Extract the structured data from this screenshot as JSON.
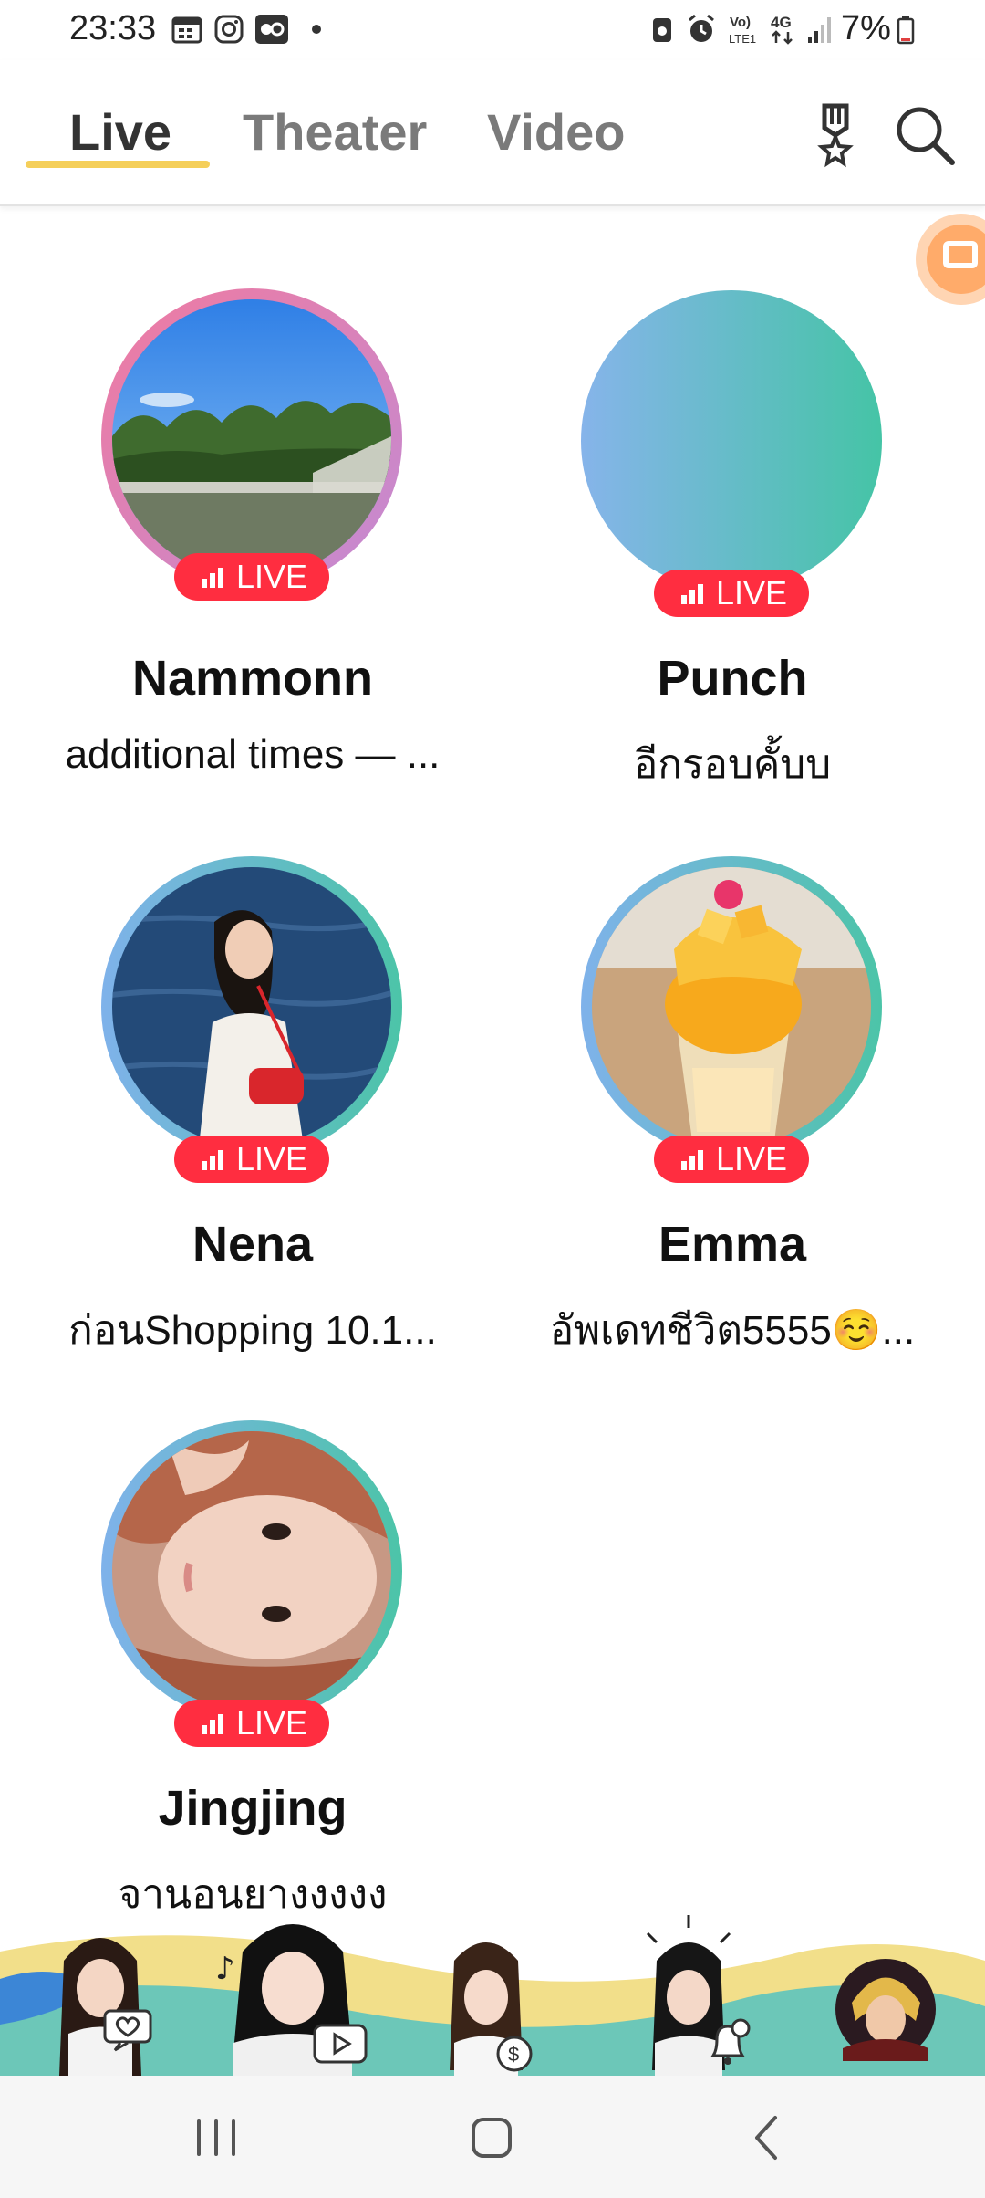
{
  "status_bar": {
    "time": "23:33",
    "battery": "7%",
    "icons": [
      "calendar-icon",
      "instagram-icon",
      "app-icon",
      "dot-icon",
      "recycle-icon",
      "alarm-icon",
      "volte-icon",
      "4g-icon",
      "signal-icon",
      "battery-icon"
    ],
    "network_top": "Vo)",
    "network_bottom": "LTE1",
    "net_type": "4G"
  },
  "header": {
    "tabs": [
      {
        "label": "Live",
        "active": true
      },
      {
        "label": "Theater",
        "active": false
      },
      {
        "label": "Video",
        "active": false
      }
    ],
    "icons": [
      "medal-icon",
      "search-icon"
    ]
  },
  "colors": {
    "accent_underline": "#f5cf5a",
    "live_badge": "#ff2d40",
    "float_button": "#ffab6a"
  },
  "streams": [
    {
      "name": "Nammonn",
      "caption": "additional times — ...",
      "badge": "LIVE"
    },
    {
      "name": "Punch",
      "caption": "อีกรอบคั้บบ",
      "badge": "LIVE"
    },
    {
      "name": "Nena",
      "caption": "ก่อนShopping 10.1...",
      "badge": "LIVE"
    },
    {
      "name": "Emma",
      "caption": "อัพเดทชีวิต5555☺️...",
      "badge": "LIVE"
    },
    {
      "name": "Jingjing",
      "caption": "จานอนยางงงงง",
      "badge": "LIVE"
    }
  ],
  "promo_strip": {
    "items": [
      "heart-message-icon",
      "play-icon",
      "coin-icon",
      "bell-icon",
      "avatar"
    ]
  },
  "navbar": {
    "buttons": [
      "recent-apps-icon",
      "home-icon",
      "back-icon"
    ]
  }
}
